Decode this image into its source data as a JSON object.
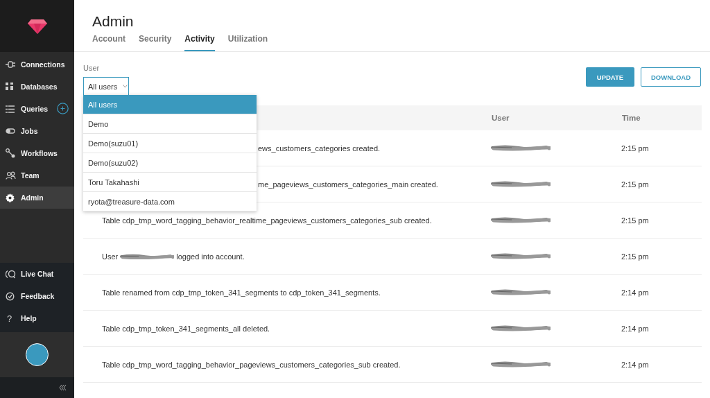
{
  "sidebar": {
    "items": [
      {
        "label": "Connections",
        "selected": false,
        "add_button": false
      },
      {
        "label": "Databases",
        "selected": false,
        "add_button": false
      },
      {
        "label": "Queries",
        "selected": false,
        "add_button": true
      },
      {
        "label": "Jobs",
        "selected": false,
        "add_button": false
      },
      {
        "label": "Workflows",
        "selected": false,
        "add_button": false
      },
      {
        "label": "Team",
        "selected": false,
        "add_button": false
      },
      {
        "label": "Admin",
        "selected": true,
        "add_button": false
      }
    ],
    "bottom_items": [
      {
        "label": "Live Chat"
      },
      {
        "label": "Feedback"
      },
      {
        "label": "Help",
        "glyph": "?"
      }
    ]
  },
  "page": {
    "title": "Admin",
    "tabs": [
      {
        "label": "Account",
        "selected": false
      },
      {
        "label": "Security",
        "selected": false
      },
      {
        "label": "Activity",
        "selected": true
      },
      {
        "label": "Utilization",
        "selected": false
      }
    ],
    "user_filter": {
      "label": "User",
      "value": "All users",
      "open": true,
      "options": [
        {
          "label": "All users",
          "selected": true
        },
        {
          "label": "Demo",
          "selected": false
        },
        {
          "label": "Demo(suzu01)",
          "selected": false
        },
        {
          "label": "Demo(suzu02)",
          "selected": false
        },
        {
          "label": "Toru Takahashi",
          "selected": false
        },
        {
          "label": "ryota@treasure-data.com",
          "selected": false
        }
      ]
    },
    "buttons": [
      {
        "label": "UPDATE",
        "kind": "primary"
      },
      {
        "label": "DOWNLOAD",
        "kind": "outline"
      }
    ],
    "table": {
      "columns": [
        "User",
        "Time"
      ],
      "rows": [
        {
          "message": [
            {
              "kind": "text",
              "text": "ews_customers_categories created."
            }
          ],
          "user_redacted": true,
          "time": "2:15 pm"
        },
        {
          "message": [
            {
              "kind": "text",
              "text": "me_pageviews_customers_categories_main created."
            }
          ],
          "user_redacted": true,
          "time": "2:15 pm"
        },
        {
          "message": [
            {
              "kind": "text",
              "text": "Table cdp_tmp_word_tagging_behavior_realtime_pageviews_customers_categories_sub created."
            }
          ],
          "user_redacted": true,
          "time": "2:15 pm"
        },
        {
          "message": [
            {
              "kind": "text",
              "text": "User"
            },
            {
              "kind": "redacted"
            },
            {
              "kind": "text",
              "text": "logged into account."
            }
          ],
          "user_redacted": true,
          "time": "2:15 pm"
        },
        {
          "message": [
            {
              "kind": "text",
              "text": "Table renamed from cdp_tmp_token_341_segments to cdp_token_341_segments."
            }
          ],
          "user_redacted": true,
          "time": "2:14 pm"
        },
        {
          "message": [
            {
              "kind": "text",
              "text": "Table cdp_tmp_token_341_segments_all deleted."
            }
          ],
          "user_redacted": true,
          "time": "2:14 pm"
        },
        {
          "message": [
            {
              "kind": "text",
              "text": "Table cdp_tmp_word_tagging_behavior_pageviews_customers_categories_sub created."
            }
          ],
          "user_redacted": true,
          "time": "2:14 pm"
        }
      ]
    }
  }
}
